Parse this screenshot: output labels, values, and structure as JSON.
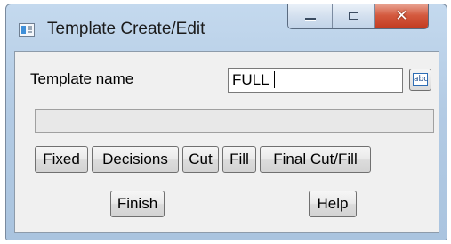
{
  "window": {
    "title": "Template Create/Edit",
    "close_glyph": "✕",
    "icons": [
      "app-icon",
      "minimize-icon",
      "maximize-icon",
      "close-icon"
    ]
  },
  "form": {
    "template_name_label": "Template name",
    "template_name_value": "FULL",
    "picker_icon_text": "abc",
    "message": ""
  },
  "buttons": {
    "fixed": "Fixed",
    "decisions": "Decisions",
    "cut": "Cut",
    "fill": "Fill",
    "final_cut_fill": "Final Cut/Fill",
    "finish": "Finish",
    "help": "Help"
  },
  "colors": {
    "frame": "#b3cbe4",
    "close_button": "#c23a20",
    "client_background": "#f0f0f0"
  }
}
